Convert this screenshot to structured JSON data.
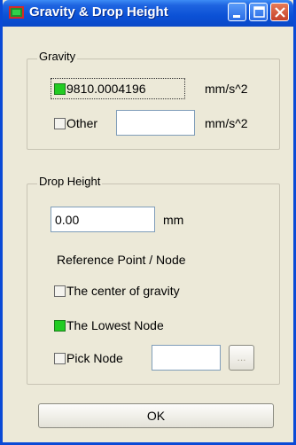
{
  "window": {
    "title": "Gravity & Drop Height",
    "colors": {
      "titlebar": "#0a4ad6",
      "face": "#ece9d8",
      "checked": "#22cc22",
      "close": "#c5412a"
    }
  },
  "gravity": {
    "group_label": "Gravity",
    "standard": {
      "value": "9810.0004196",
      "unit": "mm/s^2",
      "checked": true
    },
    "other": {
      "label": "Other",
      "value": "",
      "unit": "mm/s^2",
      "checked": false
    }
  },
  "drop_height": {
    "group_label": "Drop Height",
    "value": "0.00",
    "unit": "mm",
    "ref_label": "Reference Point / Node",
    "options": [
      {
        "label": "The center of gravity",
        "checked": false
      },
      {
        "label": "The Lowest Node",
        "checked": true
      },
      {
        "label": "Pick Node",
        "checked": false
      }
    ],
    "pick_node_value": "",
    "browse_label": "..."
  },
  "ok_label": "OK",
  "icons": [
    "app-icon",
    "minimize-icon",
    "maximize-icon",
    "close-icon"
  ]
}
